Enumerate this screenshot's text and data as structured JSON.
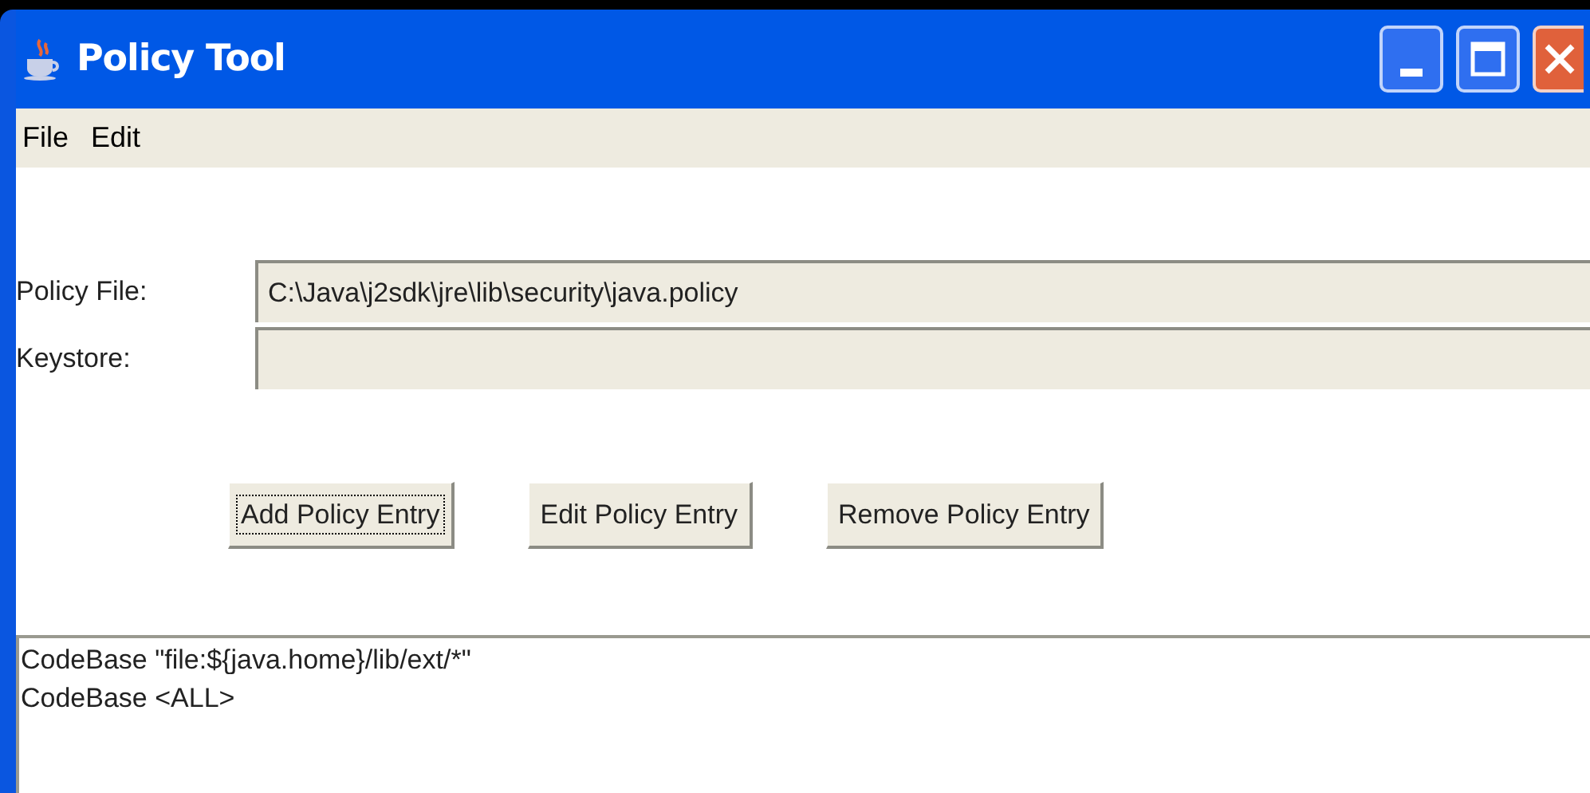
{
  "window": {
    "title": "Policy Tool"
  },
  "menu": [
    "File",
    "Edit"
  ],
  "fields": [
    {
      "label": "Policy File:",
      "value": "C:\\Java\\j2sdk\\jre\\lib\\security\\java.policy"
    },
    {
      "label": "Keystore:"
    }
  ],
  "buttons": [
    {
      "label": "Add Policy Entry",
      "focused": true
    },
    {
      "label": "Edit Policy Entry",
      "focused": false
    },
    {
      "label": "Remove Policy Entry",
      "focused": false
    }
  ],
  "entries": [
    "CodeBase \"file:${java.home}/lib/ext/*\"",
    "CodeBase <ALL>"
  ]
}
